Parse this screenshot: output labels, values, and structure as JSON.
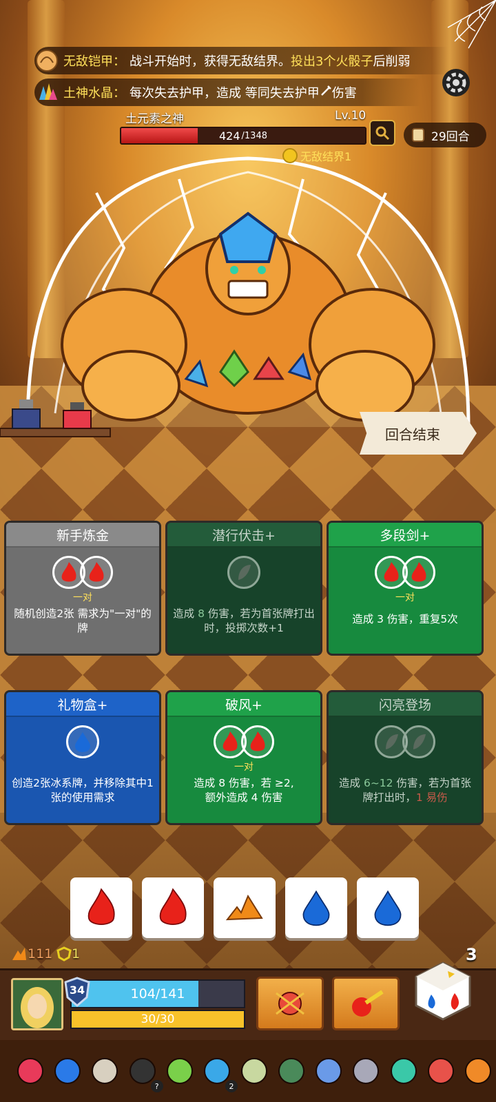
{
  "buffs": [
    {
      "name": "无敌铠甲：",
      "text_a": "战斗开始时，获得无敌结界。",
      "highlight": "投出3个火骰子",
      "text_b": "后削弱",
      "icon": "armor-shell-icon"
    },
    {
      "name": "土神水晶：",
      "text_a": "每次失去护甲，造成 等同失去护甲",
      "highlight": "",
      "text_b": "伤害",
      "icon": "crystal-cluster-icon"
    }
  ],
  "boss": {
    "name": "土元素之神",
    "level": "Lv.10",
    "hp": 424,
    "hp_max": 1348,
    "hp_text": "424",
    "hp_max_text": "/1348",
    "status": "无敌结界1"
  },
  "turns": {
    "label": "29回合"
  },
  "end_turn": {
    "label": "回合结束"
  },
  "cards": [
    {
      "title": "新手炼金",
      "style": "gray",
      "dice": [
        "fire",
        "fire"
      ],
      "pair": "一对",
      "desc": "随机创造2张 需求为\"一对\"的牌"
    },
    {
      "title": "潜行伏击+",
      "style": "dkgreen",
      "dice": [
        "earth-dim"
      ],
      "pair": "",
      "desc_a": "造成 ",
      "desc_hl": "8",
      "desc_b": " 伤害，若为首张牌打出时，投掷次数+1"
    },
    {
      "title": "多段剑+",
      "style": "green",
      "dice": [
        "fire",
        "fire"
      ],
      "pair": "一对",
      "desc": "造成 3 伤害，重复5次"
    },
    {
      "title": "礼物盒+",
      "style": "blue",
      "dice": [
        "water"
      ],
      "pair": "",
      "desc": "创造2张冰系牌，并移除其中1张的使用需求"
    },
    {
      "title": "破风+",
      "style": "green",
      "dice": [
        "fire",
        "fire"
      ],
      "pair": "一对",
      "desc_l1": "造成 8 伤害，若 ≥2,",
      "desc_l2": "额外造成 4 伤害"
    },
    {
      "title": "闪亮登场",
      "style": "dkgreen",
      "dice": [
        "earth-dim",
        "earth-dim"
      ],
      "pair": "",
      "desc_a": "造成 ",
      "desc_hl": "6~12",
      "desc_b": " 伤害，若为首张牌打出时，",
      "desc_c": "1 易伤"
    }
  ],
  "tray": [
    "fire",
    "fire",
    "earth",
    "water",
    "water"
  ],
  "stats": {
    "energy": "111",
    "shield": "1"
  },
  "player": {
    "armor": "34",
    "hp": 104,
    "hp_max": 141,
    "hp_text": "104/141",
    "mp": 30,
    "mp_max": 30,
    "mp_text": "30/30"
  },
  "dice_remaining": "3",
  "relics": [
    {
      "icon": "red-gem-icon"
    },
    {
      "icon": "blue-wisp-icon"
    },
    {
      "icon": "scroll-icon"
    },
    {
      "icon": "magic-hat-icon",
      "badge": "?"
    },
    {
      "icon": "leaf-icon"
    },
    {
      "icon": "blue-orb-icon",
      "badge": "2"
    },
    {
      "icon": "feather-icon"
    },
    {
      "icon": "turtle-shell-icon"
    },
    {
      "icon": "snowflake-icon"
    },
    {
      "icon": "silver-bowl-icon"
    },
    {
      "icon": "green-mask-icon"
    },
    {
      "icon": "totem-icon"
    },
    {
      "icon": "orange-cloth-icon"
    }
  ],
  "colors": {
    "fire": "#e8221a",
    "water": "#1a6ad8",
    "earth": "#f08a18",
    "accent": "#ffe05a"
  }
}
